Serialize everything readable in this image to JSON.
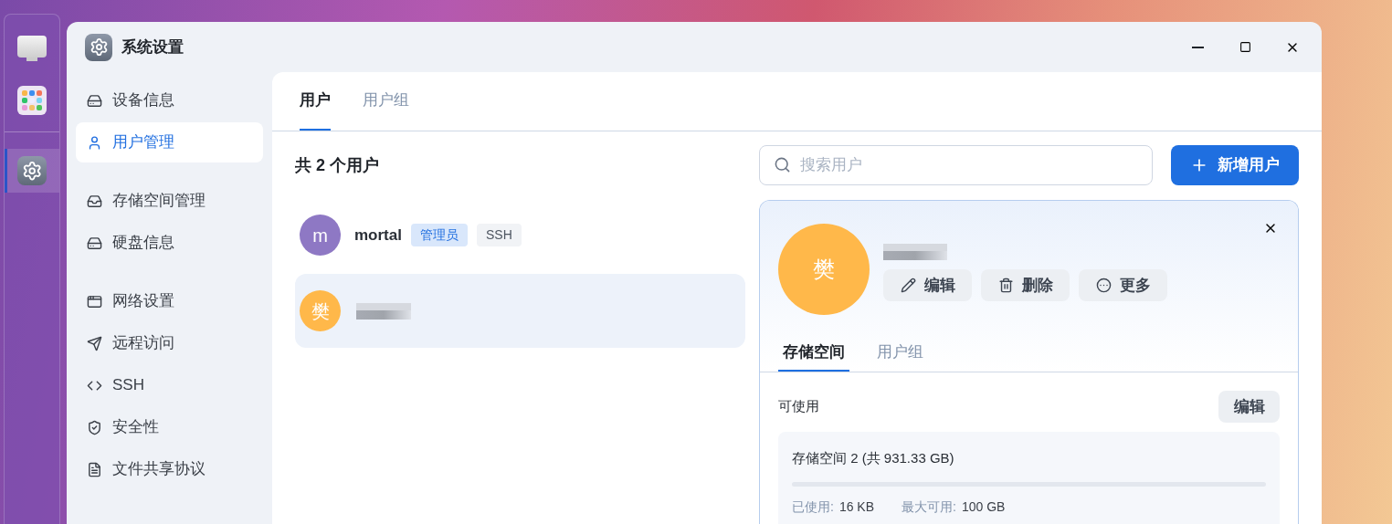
{
  "dock": [
    {
      "kind": "monitor",
      "selected": false
    },
    {
      "kind": "apps",
      "selected": false
    },
    {
      "kind": "settings",
      "selected": true
    }
  ],
  "window": {
    "title": "系统设置"
  },
  "sidebar": {
    "groups": [
      [
        {
          "label": "设备信息",
          "selected": false
        },
        {
          "label": "用户管理",
          "selected": true
        }
      ],
      [
        {
          "label": "存储空间管理",
          "selected": false
        },
        {
          "label": "硬盘信息",
          "selected": false
        }
      ],
      [
        {
          "label": "网络设置",
          "selected": false
        },
        {
          "label": "远程访问",
          "selected": false
        },
        {
          "label": "SSH",
          "selected": false
        },
        {
          "label": "安全性",
          "selected": false
        },
        {
          "label": "文件共享协议",
          "selected": false
        }
      ]
    ]
  },
  "tabs": [
    {
      "label": "用户",
      "selected": true
    },
    {
      "label": "用户组",
      "selected": false
    }
  ],
  "user_count": "共 2 个用户",
  "search": {
    "placeholder": "搜索用户"
  },
  "add_button": "新增用户",
  "users": [
    {
      "avatar": "m",
      "color": "#8e78c4",
      "name": "mortal",
      "selected": false,
      "tags": [
        {
          "label": "管理员",
          "kind": "admin"
        },
        {
          "label": "SSH",
          "kind": "plain"
        }
      ]
    },
    {
      "avatar": "樊",
      "color": "#ffb84a",
      "selected": true
    }
  ],
  "detail": {
    "avatar": "樊",
    "color": "#ffb84a",
    "actions": [
      {
        "label": "编辑"
      },
      {
        "label": "删除"
      },
      {
        "label": "更多"
      }
    ],
    "tabs": [
      {
        "label": "存储空间",
        "selected": true
      },
      {
        "label": "用户组",
        "selected": false
      }
    ],
    "section_label": "可使用",
    "edit_button": "编辑",
    "storage": {
      "title": "存储空间 2 (共 931.33 GB)",
      "level": 0,
      "used_label": "已使用:",
      "used": "16 KB",
      "max_label": "最大可用:",
      "max": "100 GB"
    }
  }
}
